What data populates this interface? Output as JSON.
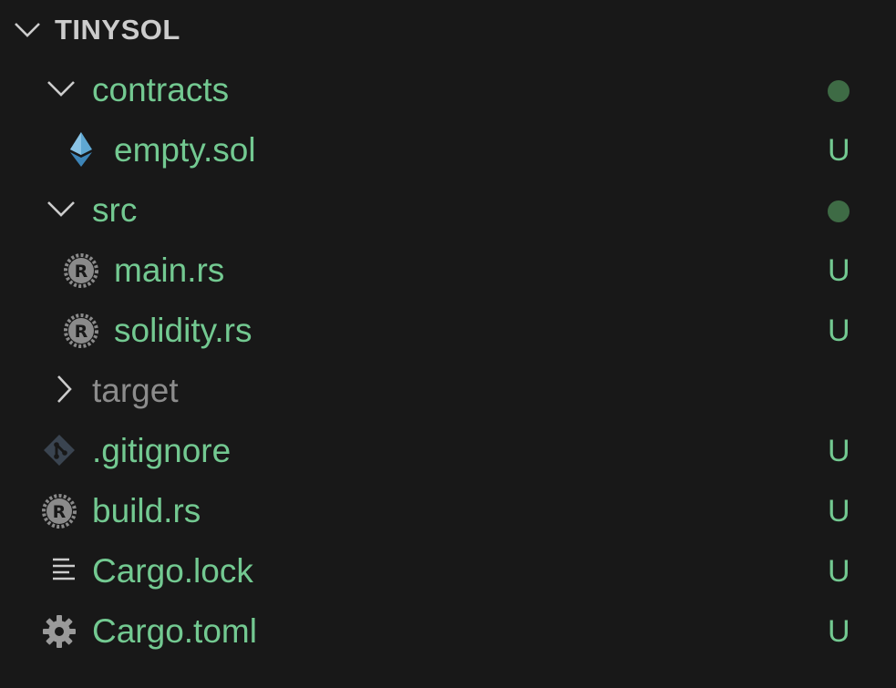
{
  "explorer": {
    "title": "TINYSOL",
    "items": [
      {
        "label": "contracts",
        "status": "",
        "icon": "chevron-down-icon"
      },
      {
        "label": "empty.sol",
        "status": "U",
        "icon": "ethereum-icon"
      },
      {
        "label": "src",
        "status": "",
        "icon": "chevron-down-icon"
      },
      {
        "label": "main.rs",
        "status": "U",
        "icon": "rust-icon"
      },
      {
        "label": "solidity.rs",
        "status": "U",
        "icon": "rust-icon"
      },
      {
        "label": "target",
        "status": "",
        "icon": "chevron-right-icon"
      },
      {
        "label": ".gitignore",
        "status": "U",
        "icon": "git-icon"
      },
      {
        "label": "build.rs",
        "status": "U",
        "icon": "rust-icon"
      },
      {
        "label": "Cargo.lock",
        "status": "U",
        "icon": "lines-icon"
      },
      {
        "label": "Cargo.toml",
        "status": "U",
        "icon": "gear-icon"
      }
    ]
  },
  "colors": {
    "background": "#181818",
    "untracked_text": "#73c991",
    "ignored_text": "#8c8c8c",
    "folder_dot": "#3e6b45"
  }
}
